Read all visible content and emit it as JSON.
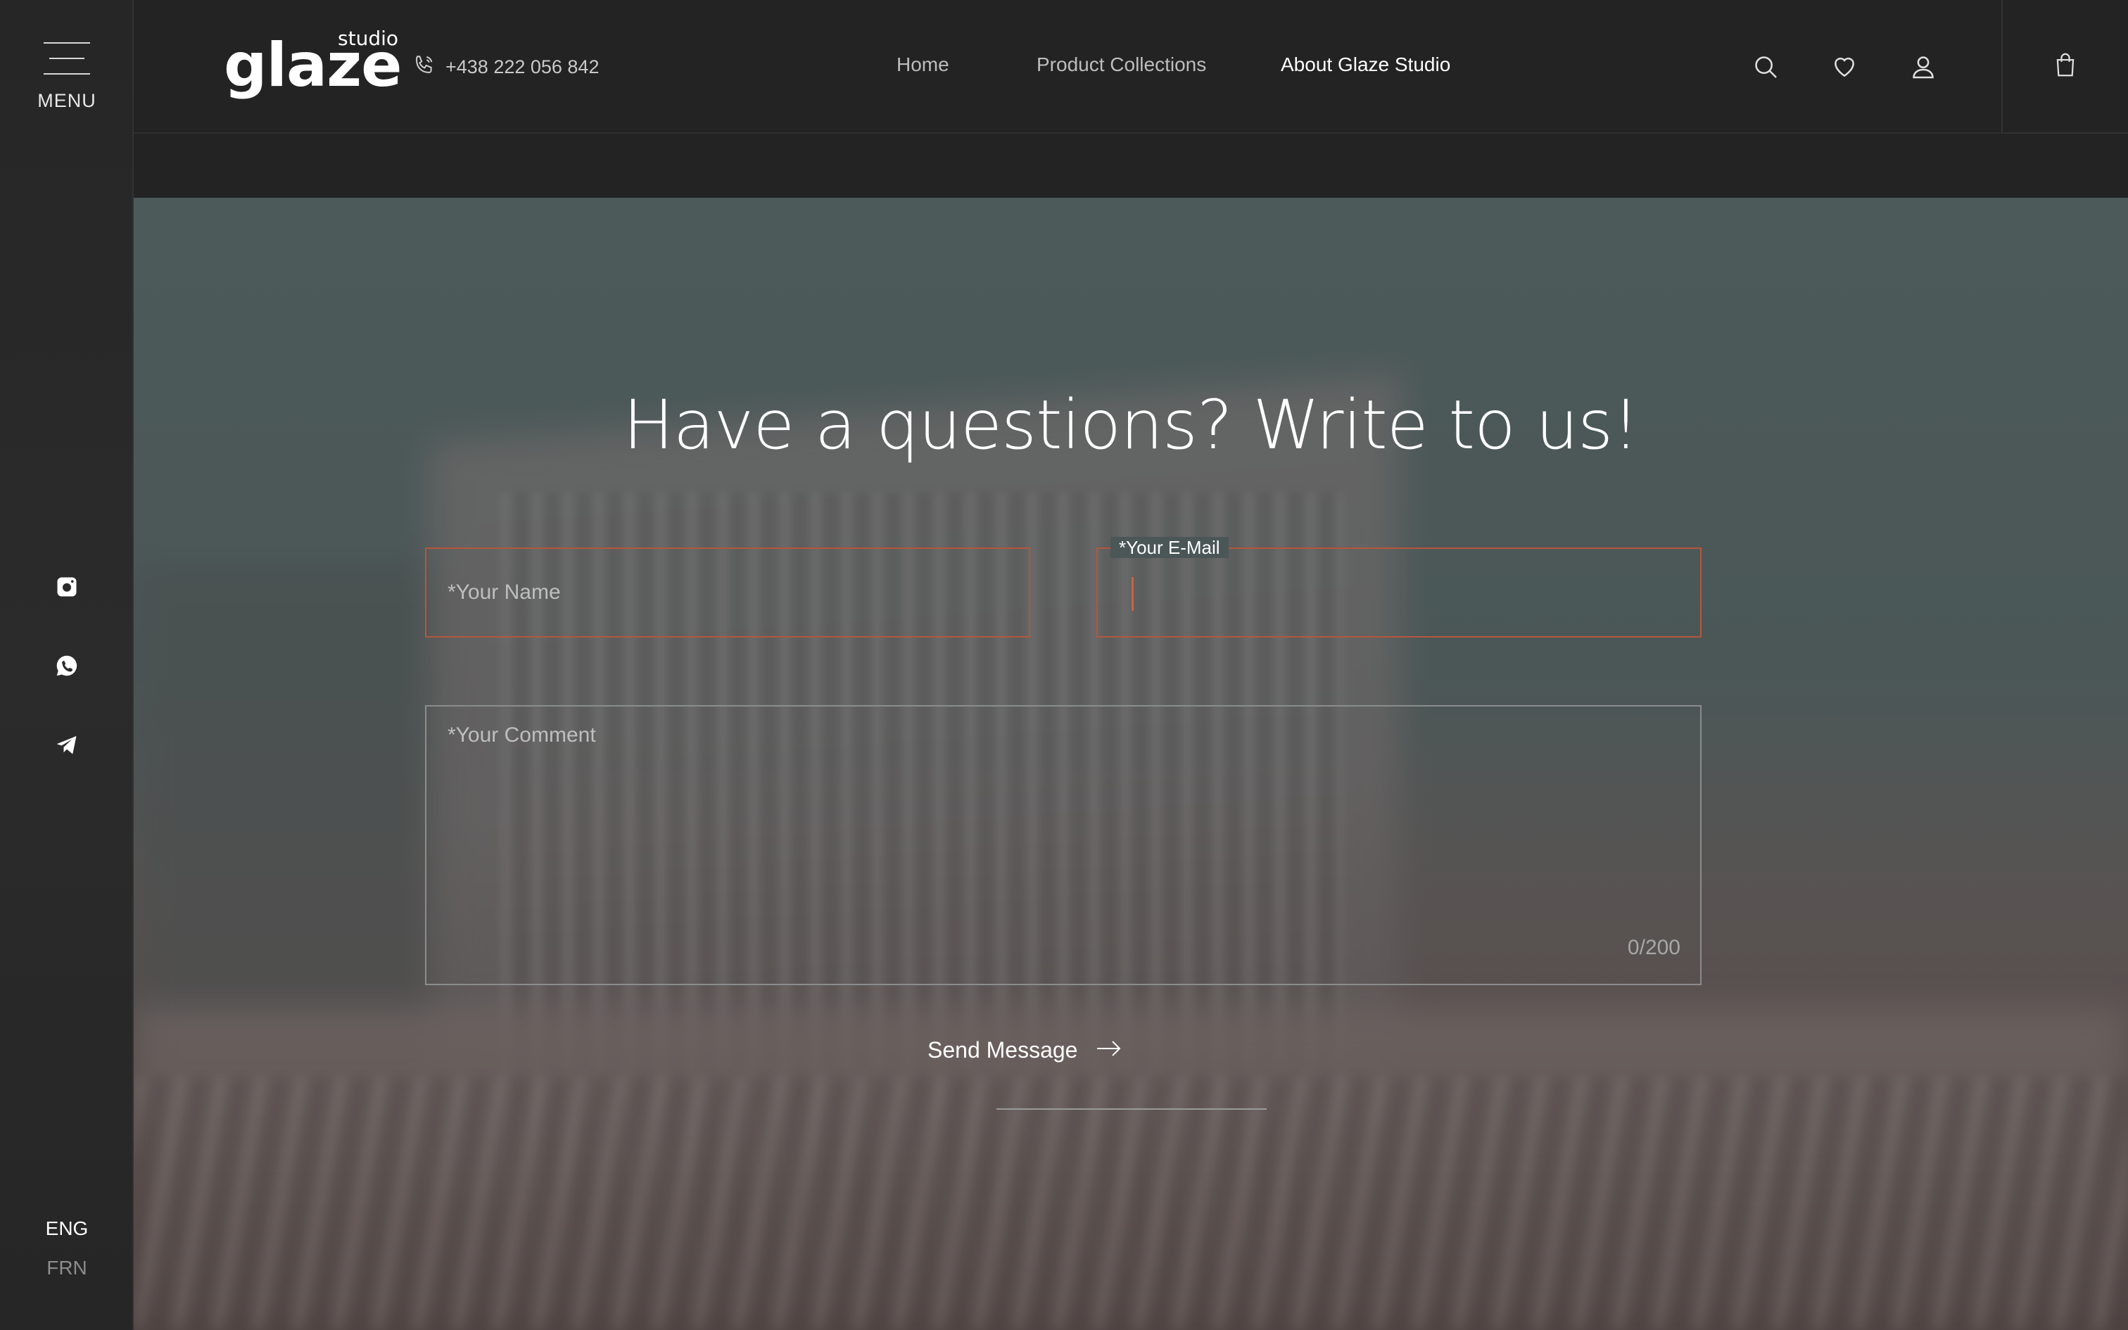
{
  "brand": {
    "name": "glaze",
    "sub": "studio"
  },
  "contact": {
    "phone": "+438 222 056 842"
  },
  "nav": {
    "home": "Home",
    "collections": "Product Collections",
    "about": "About Glaze Studio"
  },
  "header_icons": [
    "search-icon",
    "heart-icon",
    "user-icon",
    "bag-icon"
  ],
  "sidebar": {
    "menu_label": "MENU",
    "social": [
      "instagram-icon",
      "whatsapp-icon",
      "telegram-icon"
    ],
    "languages": {
      "active": "ENG",
      "inactive": "FRN"
    }
  },
  "form": {
    "title": "Have a questions? Write to us!",
    "name_placeholder": "*Your Name",
    "email_label": "*Your E-Mail",
    "email_value": "",
    "comment_placeholder": "*Your Comment",
    "counter": "0/200",
    "submit_label": "Send Message"
  },
  "colors": {
    "accent": "#b5573a",
    "background": "#232323",
    "text": "#ffffff"
  }
}
